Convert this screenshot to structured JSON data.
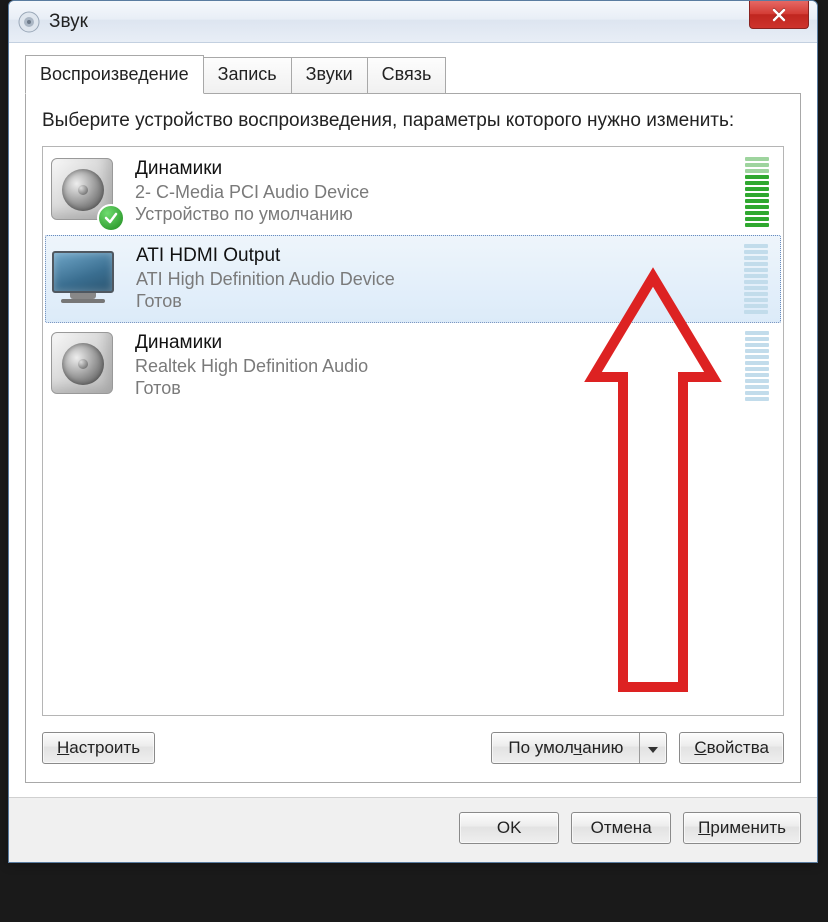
{
  "window": {
    "title": "Звук"
  },
  "tabs": [
    {
      "label": "Воспроизведение",
      "active": true
    },
    {
      "label": "Запись",
      "active": false
    },
    {
      "label": "Звуки",
      "active": false
    },
    {
      "label": "Связь",
      "active": false
    }
  ],
  "instruction": "Выберите устройство воспроизведения, параметры которого нужно изменить:",
  "devices": [
    {
      "name": "Динамики",
      "desc": "2- C-Media PCI Audio Device",
      "status": "Устройство по умолчанию",
      "icon": "speaker",
      "default": true,
      "selected": false,
      "vu_color": "green",
      "vu_bars": 12,
      "vu_active": 9
    },
    {
      "name": "ATI HDMI Output",
      "desc": "ATI High Definition Audio Device",
      "status": "Готов",
      "icon": "monitor",
      "default": false,
      "selected": true,
      "vu_color": "blue",
      "vu_bars": 12,
      "vu_active": 0
    },
    {
      "name": "Динамики",
      "desc": "Realtek High Definition Audio",
      "status": "Готов",
      "icon": "speaker",
      "default": false,
      "selected": false,
      "vu_color": "blue",
      "vu_bars": 12,
      "vu_active": 0
    }
  ],
  "buttons": {
    "configure": "Настроить",
    "default": "По умолчанию",
    "properties": "Свойства",
    "ok": "OK",
    "cancel": "Отмена",
    "apply": "Применить"
  },
  "annotation": {
    "type": "arrow",
    "color": "#d22",
    "points_to": "devices.1"
  }
}
